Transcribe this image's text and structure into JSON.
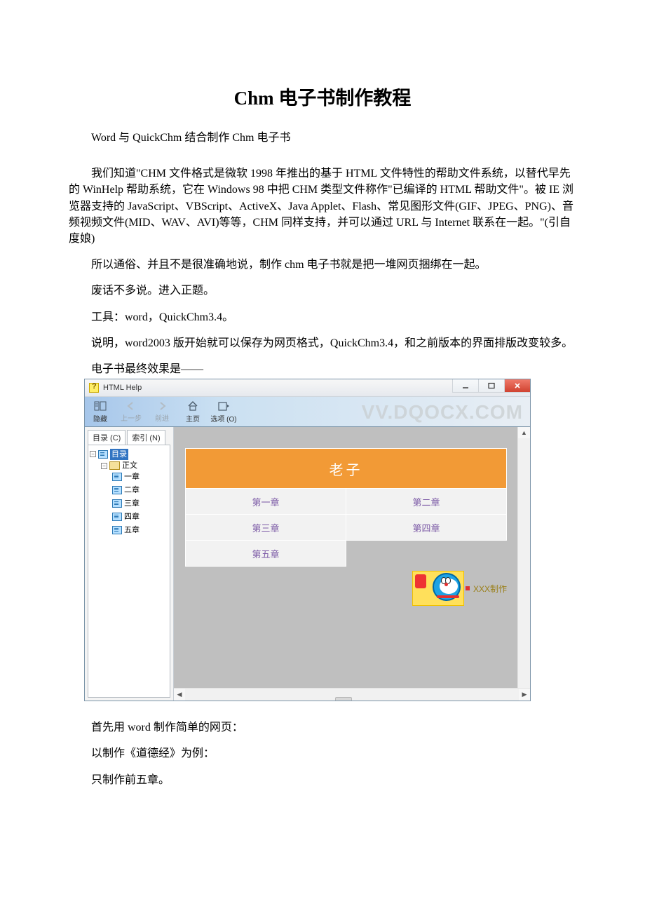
{
  "title": "Chm 电子书制作教程",
  "paragraphs": {
    "p1": "Word 与 QuickChm 结合制作 Chm 电子书",
    "p2": "我们知道\"CHM 文件格式是微软 1998 年推出的基于 HTML 文件特性的帮助文件系统，以替代早先的 WinHelp 帮助系统，它在 Windows 98 中把 CHM 类型文件称作\"已编译的 HTML 帮助文件\"。被 IE 浏览器支持的 JavaScript、VBScript、ActiveX、Java Applet、Flash、常见图形文件(GIF、JPEG、PNG)、音频视频文件(MID、WAV、AVI)等等，CHM 同样支持，并可以通过 URL 与 Internet 联系在一起。\"(引自度娘)",
    "p3": "所以通俗、并且不是很准确地说，制作 chm 电子书就是把一堆网页捆绑在一起。",
    "p4": "废话不多说。进入正题。",
    "p5": "工具：word，QuickChm3.4。",
    "p6": "说明，word2003 版开始就可以保存为网页格式，QuickChm3.4，和之前版本的界面排版改变较多。",
    "p7": "电子书最终效果是——",
    "p8": "首先用 word 制作简单的网页：",
    "p9": "以制作《道德经》为例：",
    "p10": "只制作前五章。"
  },
  "chm": {
    "app_title": "HTML Help",
    "toolbar": {
      "hide": "隐藏",
      "back": "上一步",
      "forward": "前进",
      "home": "主页",
      "options": "选项 (O)"
    },
    "watermark": "VV.DQOCX.COM",
    "nav": {
      "tab_contents": "目录 (C)",
      "tab_index": "索引 (N)",
      "tree": {
        "root": "目录",
        "body": "正文",
        "ch1": "一章",
        "ch2": "二章",
        "ch3": "三章",
        "ch4": "四章",
        "ch5": "五章"
      }
    },
    "content": {
      "book_title": "老子",
      "chapters": {
        "c1": "第一章",
        "c2": "第二章",
        "c3": "第三章",
        "c4": "第四章",
        "c5": "第五章"
      },
      "credit": "XXX制作"
    }
  }
}
